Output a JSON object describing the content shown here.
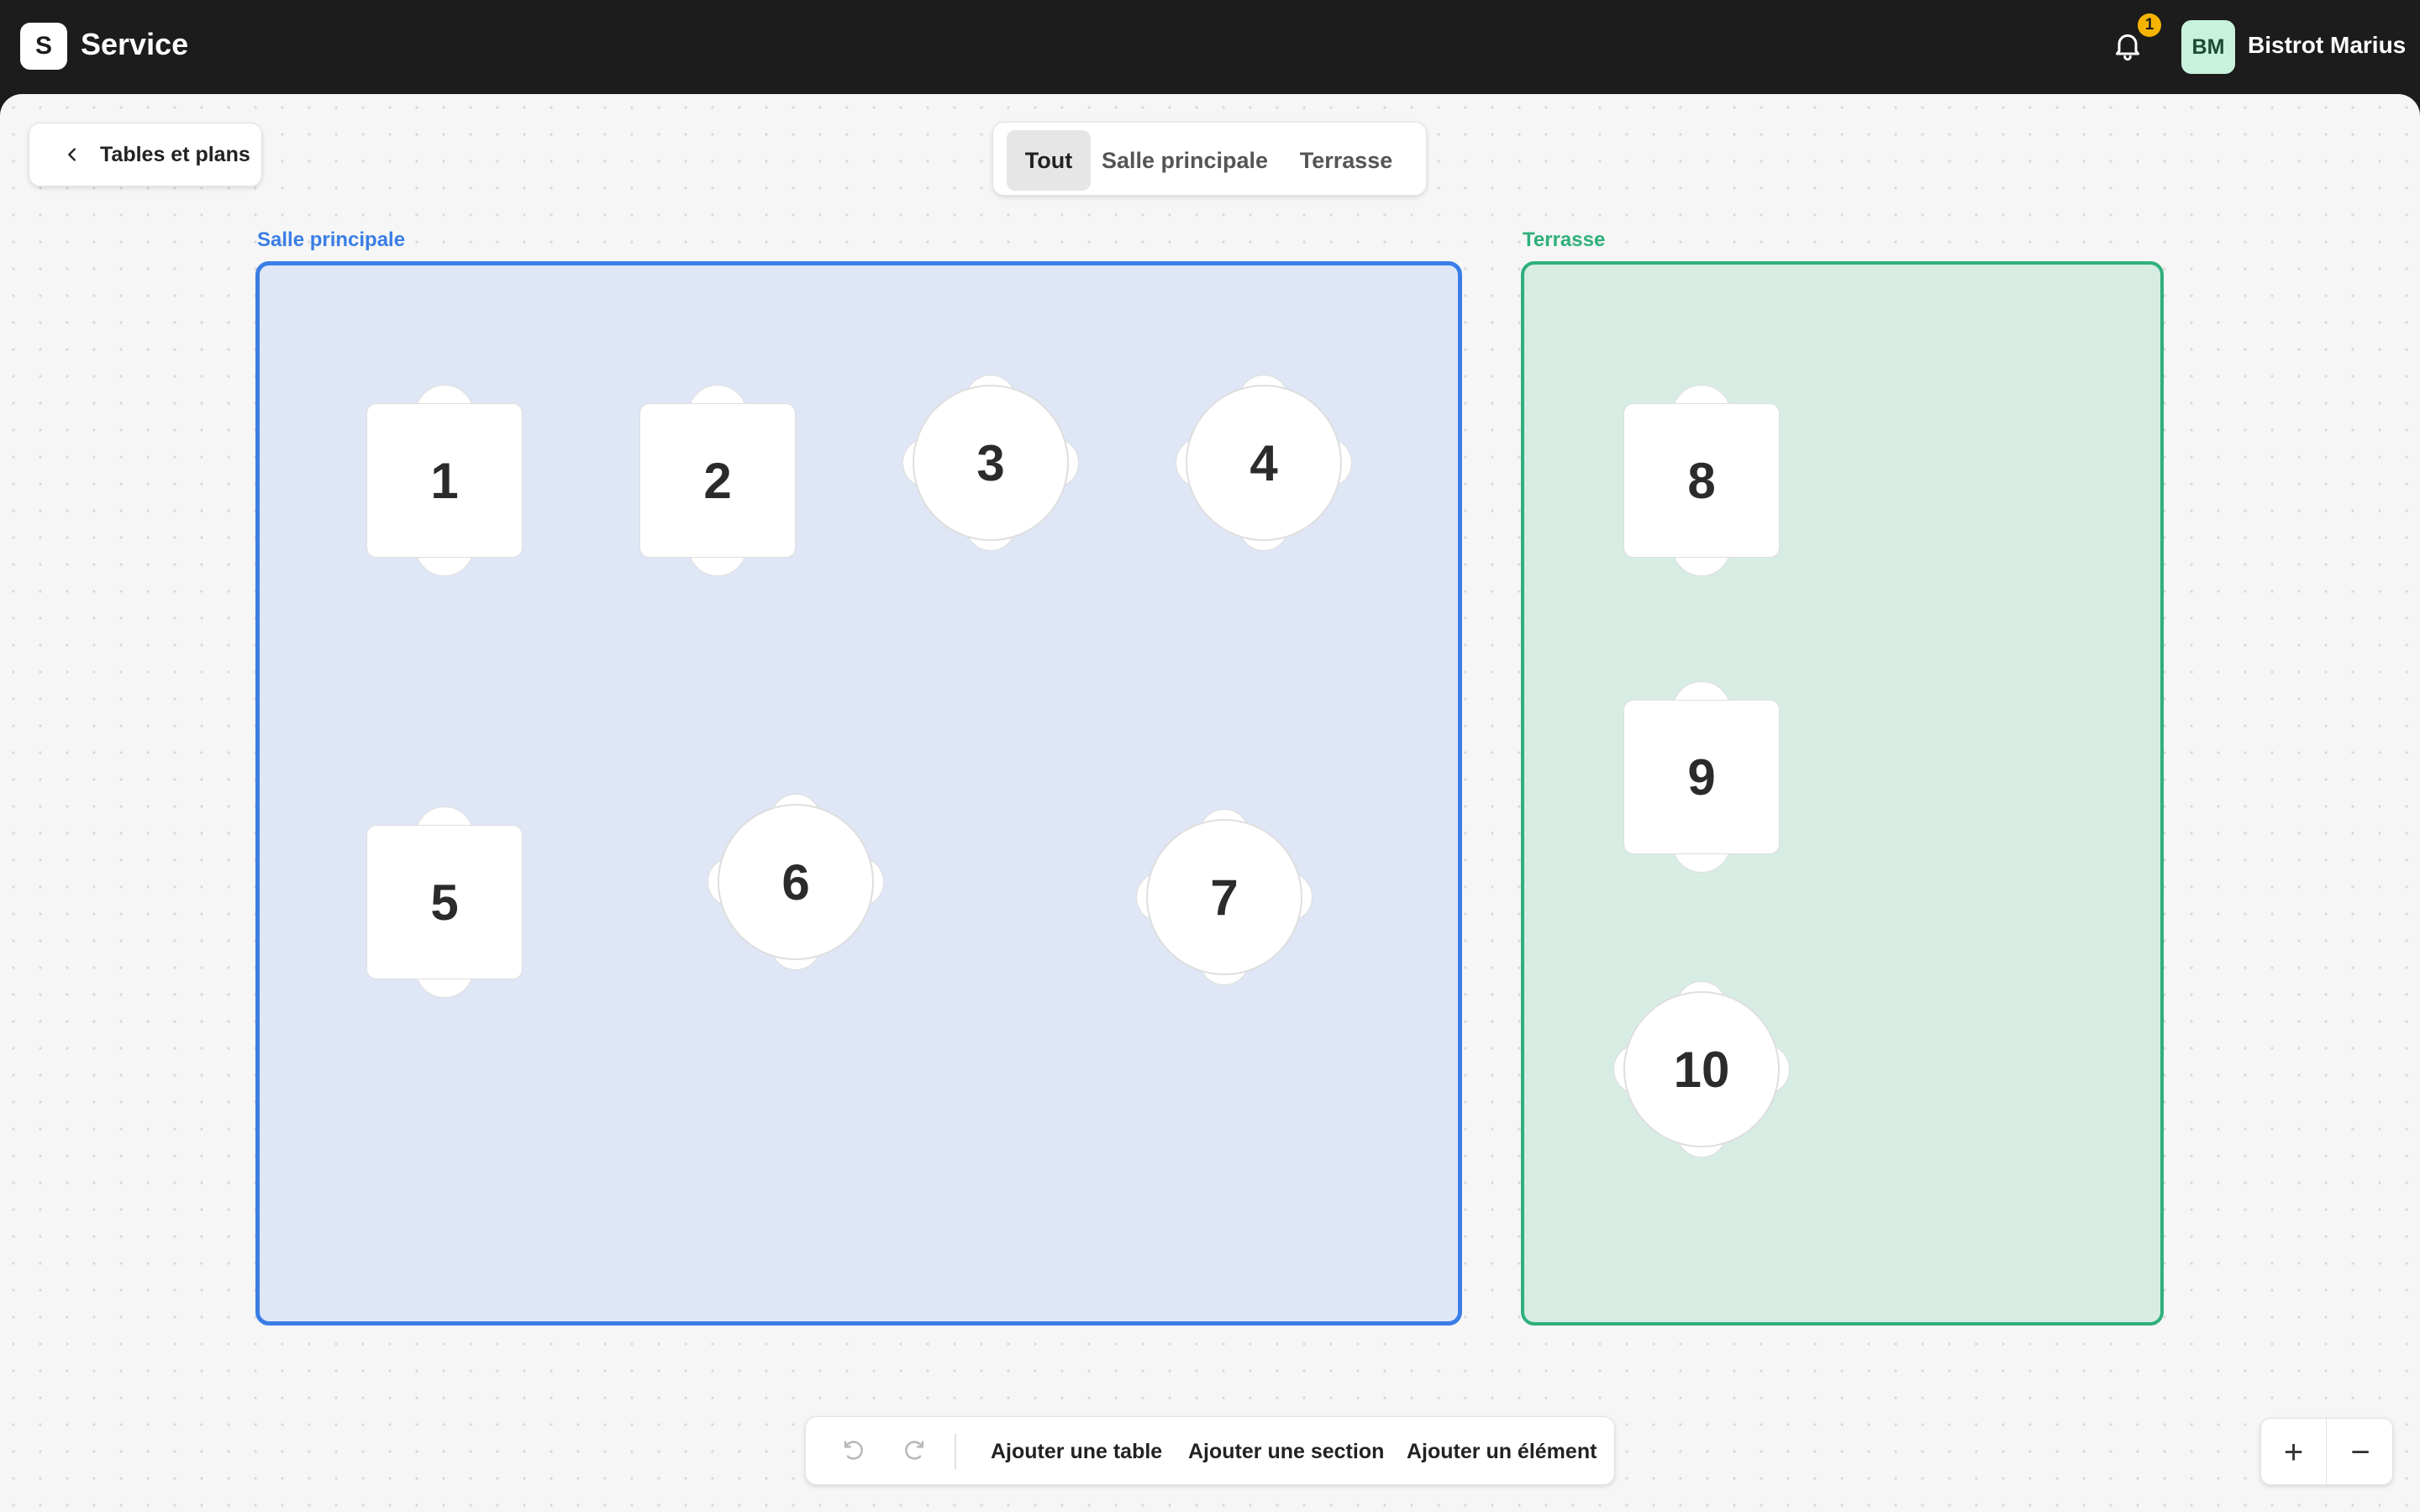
{
  "header": {
    "logo_letter": "S",
    "app_title": "Service",
    "notification_count": "1",
    "avatar_initials": "BM",
    "account_name": "Bistrot Marius"
  },
  "back_button": {
    "label": "Tables et plans"
  },
  "tabs": [
    {
      "label": "Tout",
      "active": true
    },
    {
      "label": "Salle principale",
      "active": false
    },
    {
      "label": "Terrasse",
      "active": false
    }
  ],
  "sections": [
    {
      "label": "Salle principale",
      "color": "#3a7ee6"
    },
    {
      "label": "Terrasse",
      "color": "#2eb07a"
    }
  ],
  "tables": [
    {
      "number": "1",
      "shape": "square",
      "section": "Salle principale"
    },
    {
      "number": "2",
      "shape": "square",
      "section": "Salle principale"
    },
    {
      "number": "3",
      "shape": "round",
      "section": "Salle principale"
    },
    {
      "number": "4",
      "shape": "round",
      "section": "Salle principale"
    },
    {
      "number": "5",
      "shape": "square",
      "section": "Salle principale"
    },
    {
      "number": "6",
      "shape": "round",
      "section": "Salle principale"
    },
    {
      "number": "7",
      "shape": "round",
      "section": "Salle principale"
    },
    {
      "number": "8",
      "shape": "square",
      "section": "Terrasse"
    },
    {
      "number": "9",
      "shape": "square",
      "section": "Terrasse"
    },
    {
      "number": "10",
      "shape": "round",
      "section": "Terrasse"
    }
  ],
  "toolbar": {
    "undo_icon": "undo-icon",
    "redo_icon": "redo-icon",
    "add_table": "Ajouter une table",
    "add_section": "Ajouter une section",
    "add_element": "Ajouter un élément"
  },
  "zoom": {
    "in": "+",
    "out": "−"
  }
}
